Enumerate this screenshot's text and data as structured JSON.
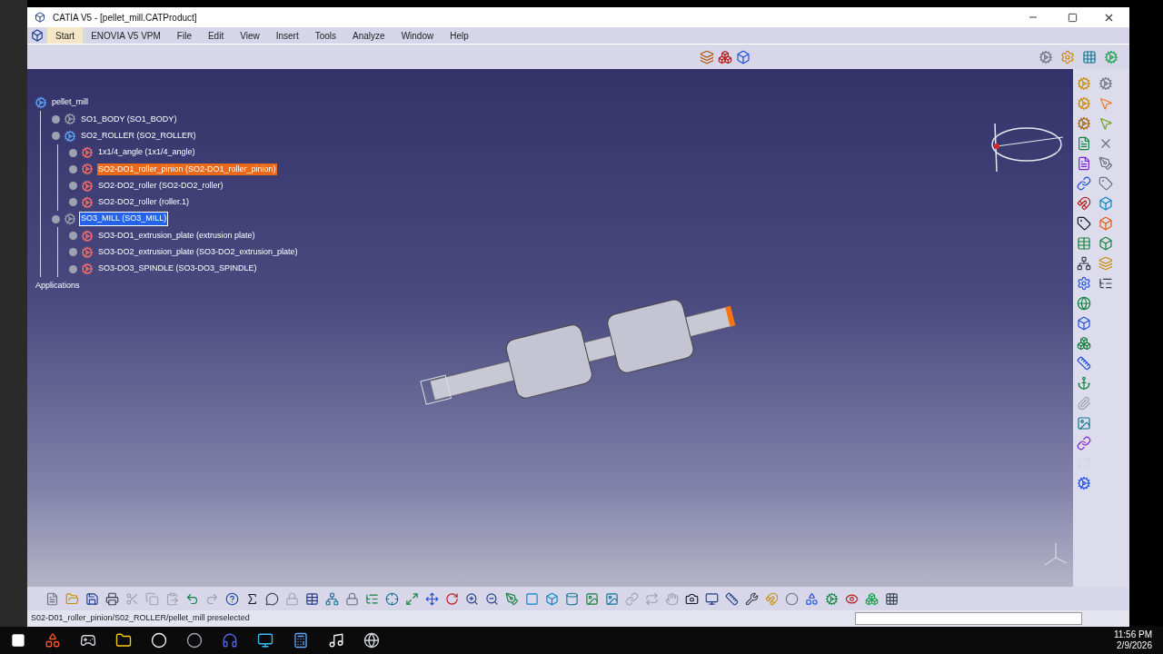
{
  "window": {
    "title": "CATIA V5 - [pellet_mill.CATProduct]"
  },
  "menu": [
    {
      "label": "Start",
      "selected": true
    },
    {
      "label": "ENOVIA V5 VPM",
      "selected": false
    },
    {
      "label": "File",
      "selected": false
    },
    {
      "label": "Edit",
      "selected": false
    },
    {
      "label": "View",
      "selected": false
    },
    {
      "label": "Insert",
      "selected": false
    },
    {
      "label": "Tools",
      "selected": false
    },
    {
      "label": "Analyze",
      "selected": false
    },
    {
      "label": "Window",
      "selected": false
    },
    {
      "label": "Help",
      "selected": false
    }
  ],
  "tree": [
    {
      "label": "pellet_mill",
      "kind": "product",
      "selected": false,
      "preselected": false,
      "children": [
        {
          "label": "SO1_BODY (SO1_BODY)",
          "kind": "component",
          "selected": false,
          "preselected": false
        },
        {
          "label": "SO2_ROLLER (SO2_ROLLER)",
          "kind": "product",
          "selected": false,
          "preselected": false,
          "children": [
            {
              "label": "1x1/4_angle (1x1/4_angle)",
              "kind": "part",
              "selected": false,
              "preselected": false
            },
            {
              "label": "SO2-DO1_roller_pinion (SO2-DO1_roller_pinion)",
              "kind": "part",
              "selected": false,
              "preselected": true
            },
            {
              "label": "SO2-DO2_roller (SO2-DO2_roller)",
              "kind": "part",
              "selected": false,
              "preselected": false
            },
            {
              "label": "SO2-DO2_roller (roller.1)",
              "kind": "part",
              "selected": false,
              "preselected": false
            }
          ]
        },
        {
          "label": "SO3_MILL (SO3_MILL)",
          "kind": "component",
          "selected": true,
          "preselected": false,
          "children": [
            {
              "label": "SO3-DO1_extrusion_plate (extrusion plate)",
              "kind": "part",
              "selected": false,
              "preselected": false
            },
            {
              "label": "SO3-DO2_extrusion_plate (SO3-DO2_extrusion_plate)",
              "kind": "part",
              "selected": false,
              "preselected": false
            },
            {
              "label": "SO3-DO3_SPINDLE (SO3-DO3_SPINDLE)",
              "kind": "part",
              "selected": false,
              "preselected": false
            }
          ]
        }
      ]
    },
    {
      "label": "Applications",
      "kind": "applications",
      "selected": false,
      "preselected": false
    }
  ],
  "status_bar": {
    "message": "S02-D01_roller_pinion/S02_ROLLER/pellet_mill preselected"
  },
  "taskbar": {
    "time": "11:56 PM",
    "date": "2/9/2026"
  }
}
